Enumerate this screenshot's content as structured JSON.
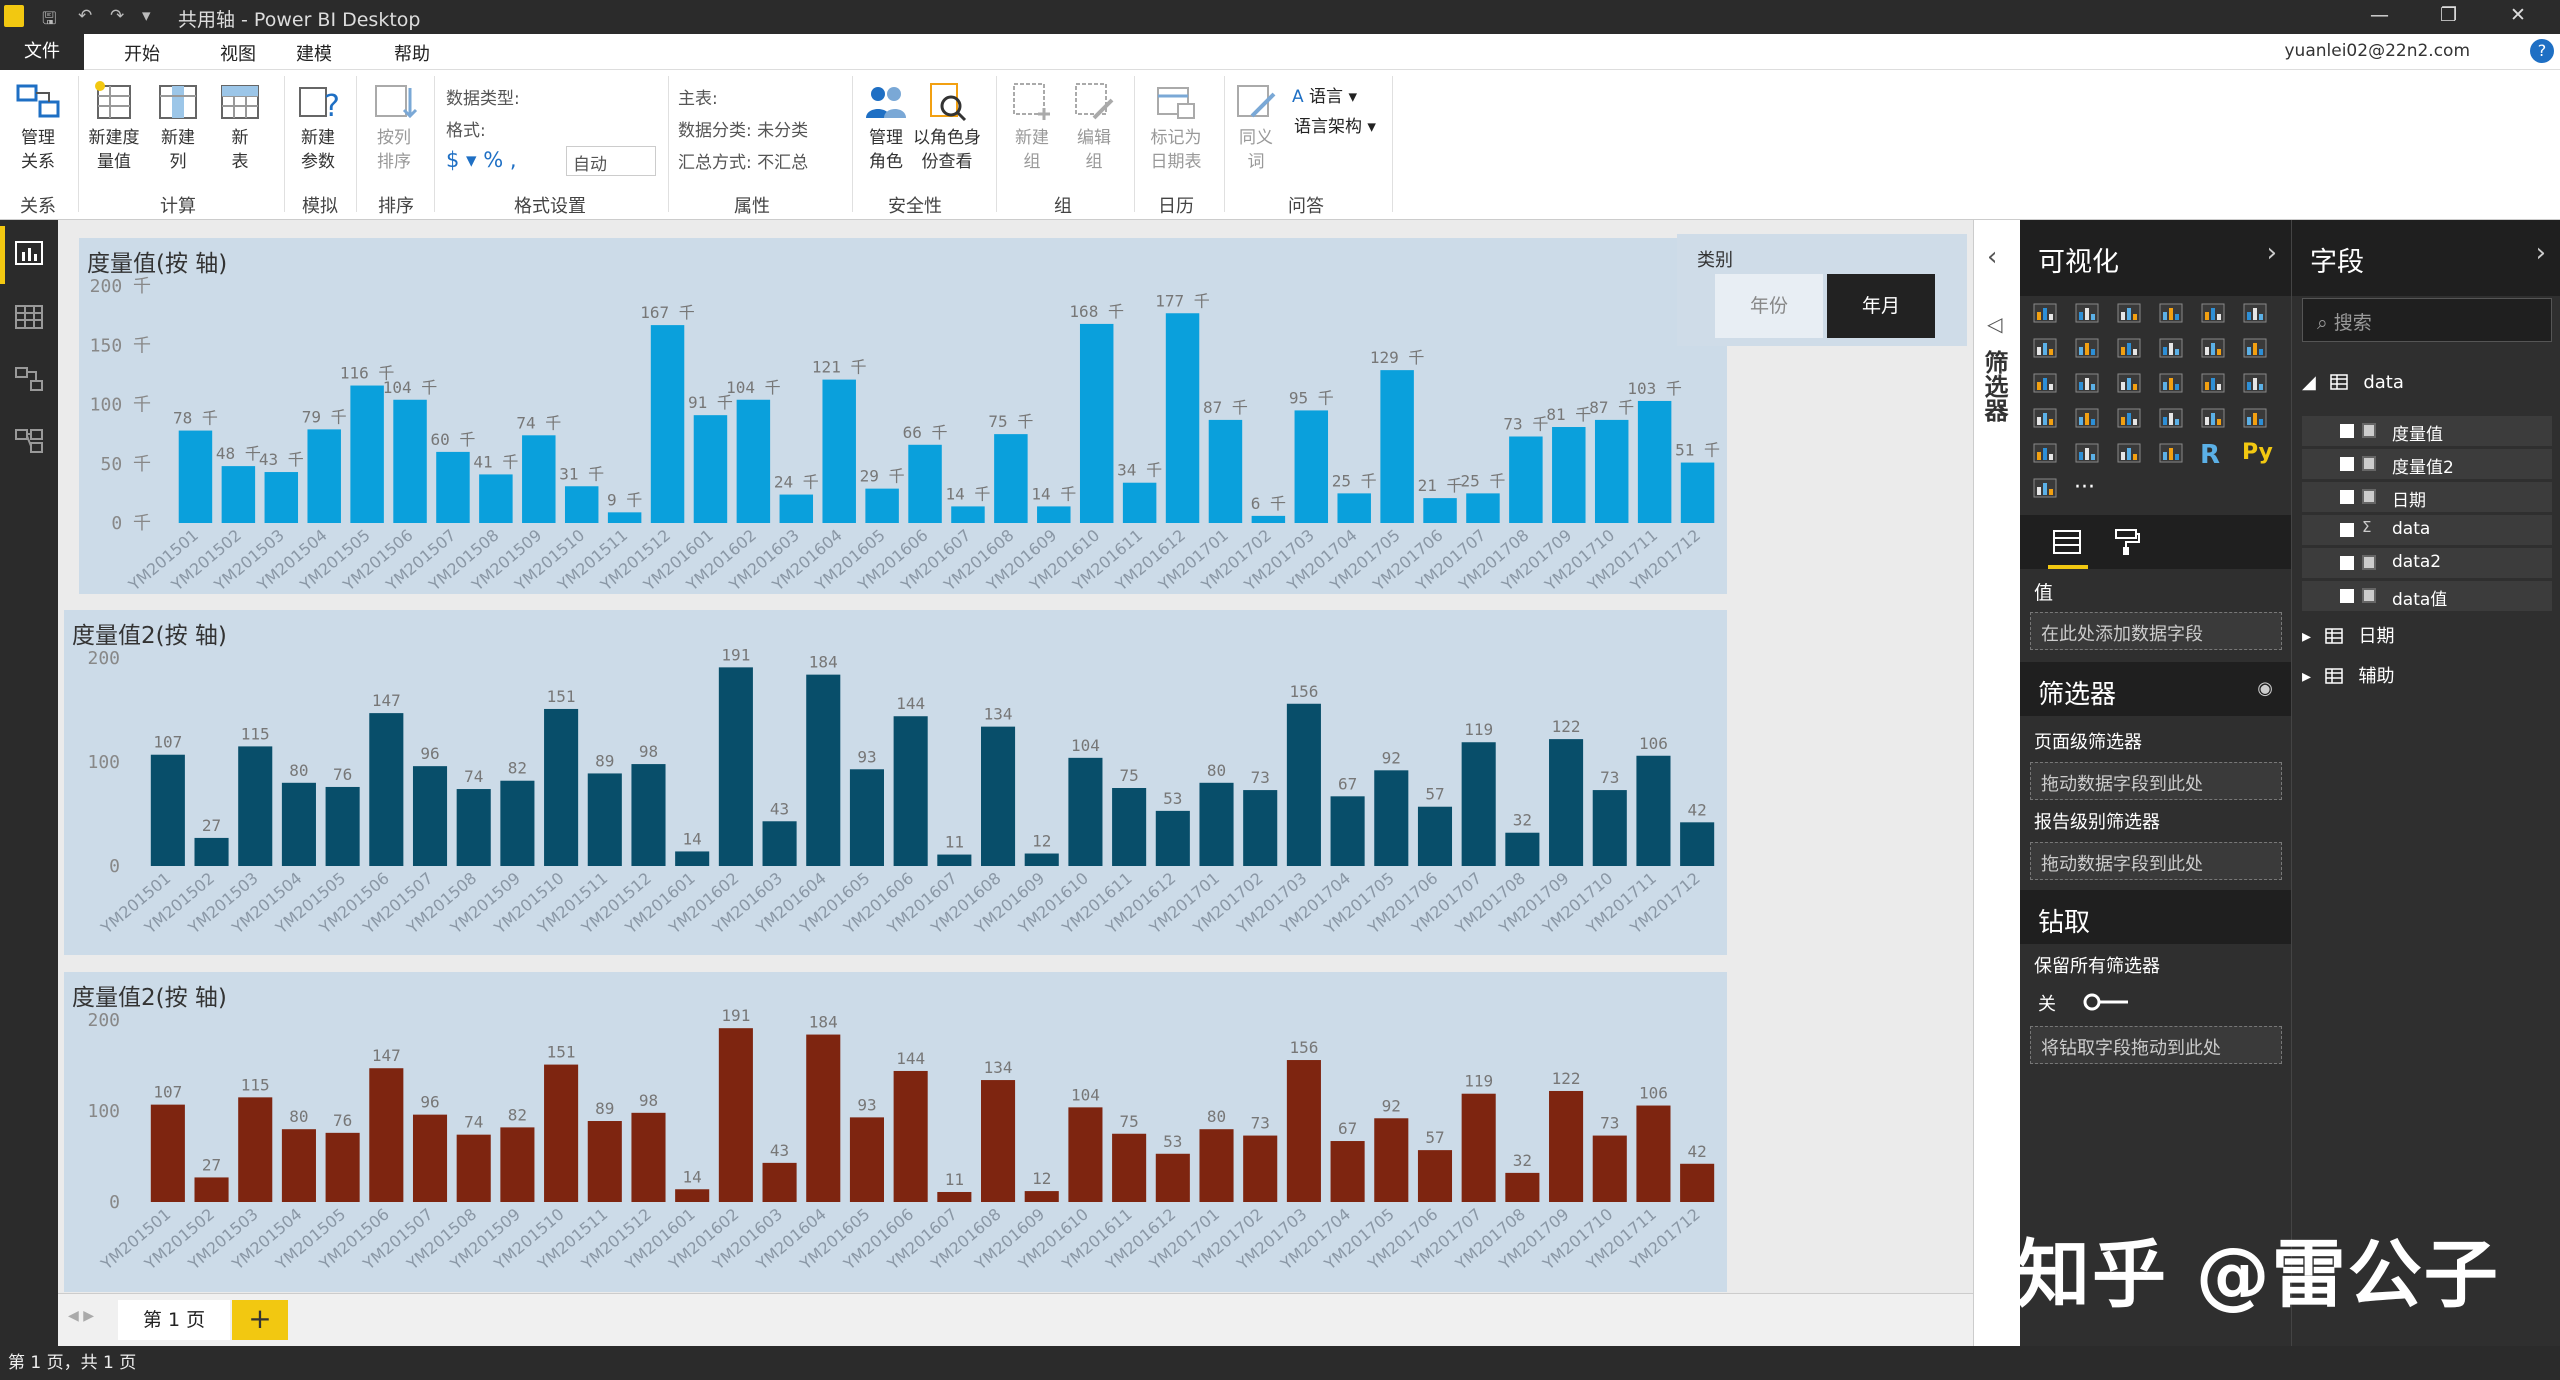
{
  "window": {
    "title": "共用轴 - Power BI Desktop",
    "user": "yuanlei02@22n2.com",
    "help": "?"
  },
  "menu": {
    "file": "文件",
    "tabs": [
      "开始",
      "视图",
      "建模",
      "帮助"
    ],
    "active": "建模"
  },
  "ribbon": {
    "buttons": [
      {
        "label1": "管理",
        "label2": "关系",
        "icon": "manage-relationships-icon"
      },
      {
        "label1": "新建度",
        "label2": "量值",
        "icon": "new-measure-icon"
      },
      {
        "label1": "新建",
        "label2": "列",
        "icon": "new-column-icon"
      },
      {
        "label1": "新",
        "label2": "表",
        "icon": "new-table-icon"
      },
      {
        "label1": "新建",
        "label2": "参数",
        "icon": "new-parameter-icon"
      },
      {
        "label1": "按列",
        "label2": "排序",
        "icon": "sort-by-column-icon"
      },
      {
        "label1": "管理",
        "label2": "角色",
        "icon": "manage-roles-icon"
      },
      {
        "label1": "以角色身",
        "label2": "份查看",
        "icon": "view-as-roles-icon"
      },
      {
        "label1": "新建",
        "label2": "组",
        "icon": "new-group-icon"
      },
      {
        "label1": "编辑",
        "label2": "组",
        "icon": "edit-groups-icon"
      },
      {
        "label1": "标记为",
        "label2": "日期表",
        "icon": "mark-date-table-icon"
      },
      {
        "label1": "同义",
        "label2": "词",
        "icon": "synonyms-icon"
      }
    ],
    "groups": [
      "关系",
      "计算",
      "模拟",
      "排序",
      "格式设置",
      "属性",
      "安全性",
      "组",
      "日历",
      "问答"
    ],
    "format": {
      "datatype": "数据类型:",
      "format": "格式:",
      "symbols": "$ ▾  %  ,",
      "auto": "自动"
    },
    "properties": {
      "home_table": "主表:",
      "data_category": "数据分类: 未分类",
      "summarize": "汇总方式: 不汇总"
    },
    "qa": {
      "language": "语言",
      "schema": "语言架构"
    }
  },
  "slicer": {
    "title": "类别",
    "options": [
      "年份",
      "年月"
    ],
    "selected": "年月"
  },
  "charts": {
    "chart1_title": "度量值(按 轴)",
    "chart2_title": "度量值2(按 轴)",
    "chart3_title": "度量值2(按 轴)"
  },
  "chart_data": [
    {
      "type": "bar",
      "title": "度量值(按 轴)",
      "categories": [
        "YM201501",
        "YM201502",
        "YM201503",
        "YM201504",
        "YM201505",
        "YM201506",
        "YM201507",
        "YM201508",
        "YM201509",
        "YM201510",
        "YM201511",
        "YM201512",
        "YM201601",
        "YM201602",
        "YM201603",
        "YM201604",
        "YM201605",
        "YM201606",
        "YM201607",
        "YM201608",
        "YM201609",
        "YM201610",
        "YM201611",
        "YM201612",
        "YM201701",
        "YM201702",
        "YM201703",
        "YM201704",
        "YM201705",
        "YM201706",
        "YM201707",
        "YM201708",
        "YM201709",
        "YM201710",
        "YM201711",
        "YM201712"
      ],
      "values": [
        78,
        48,
        43,
        79,
        116,
        104,
        60,
        41,
        74,
        31,
        9,
        167,
        91,
        104,
        24,
        121,
        29,
        66,
        14,
        75,
        14,
        168,
        34,
        177,
        87,
        6,
        95,
        25,
        129,
        21,
        25,
        73,
        81,
        87,
        103,
        51
      ],
      "labels": [
        "78 千",
        "48 千",
        "43 千",
        "79 千",
        "116 千",
        "104 千",
        "60 千",
        "41 千",
        "74 千",
        "31 千",
        "9 千",
        "167 千",
        "91 千",
        "104 千",
        "24 千",
        "121 千",
        "29 千",
        "66 千",
        "14 千",
        "75 千",
        "14 千",
        "168 千",
        "34 千",
        "177 千",
        "87 千",
        "6 千",
        "95 千",
        "25 千",
        "129 千",
        "21 千",
        "25 千",
        "73 千",
        "81 千",
        "87 千",
        "103 千",
        "51 千"
      ],
      "yticks": [
        "200 千",
        "150 千",
        "100 千",
        "50 千",
        "0 千"
      ],
      "ylim": [
        0,
        200
      ],
      "color": "#0aa0dc"
    },
    {
      "type": "bar",
      "title": "度量值2(按 轴)",
      "categories": [
        "YM201501",
        "YM201502",
        "YM201503",
        "YM201504",
        "YM201505",
        "YM201506",
        "YM201507",
        "YM201508",
        "YM201509",
        "YM201510",
        "YM201511",
        "YM201512",
        "YM201601",
        "YM201602",
        "YM201603",
        "YM201604",
        "YM201605",
        "YM201606",
        "YM201607",
        "YM201608",
        "YM201609",
        "YM201610",
        "YM201611",
        "YM201612",
        "YM201701",
        "YM201702",
        "YM201703",
        "YM201704",
        "YM201705",
        "YM201706",
        "YM201707",
        "YM201708",
        "YM201709",
        "YM201710",
        "YM201711",
        "YM201712"
      ],
      "values": [
        107,
        27,
        115,
        80,
        76,
        147,
        96,
        74,
        82,
        151,
        89,
        98,
        14,
        191,
        43,
        184,
        93,
        144,
        11,
        134,
        12,
        104,
        75,
        53,
        80,
        73,
        156,
        67,
        92,
        57,
        119,
        32,
        122,
        73,
        106,
        42
      ],
      "labels": [
        "107",
        "27",
        "115",
        "80",
        "76",
        "147",
        "96",
        "74",
        "82",
        "151",
        "89",
        "98",
        "14",
        "191",
        "43",
        "184",
        "93",
        "144",
        "11",
        "134",
        "12",
        "104",
        "75",
        "53",
        "80",
        "73",
        "156",
        "67",
        "92",
        "57",
        "119",
        "32",
        "122",
        "73",
        "106",
        "42"
      ],
      "yticks": [
        "200",
        "100",
        "0"
      ],
      "ylim": [
        0,
        200
      ],
      "color": "#084e6a"
    },
    {
      "type": "bar",
      "title": "度量值2(按 轴)",
      "categories": [
        "YM201501",
        "YM201502",
        "YM201503",
        "YM201504",
        "YM201505",
        "YM201506",
        "YM201507",
        "YM201508",
        "YM201509",
        "YM201510",
        "YM201511",
        "YM201512",
        "YM201601",
        "YM201602",
        "YM201603",
        "YM201604",
        "YM201605",
        "YM201606",
        "YM201607",
        "YM201608",
        "YM201609",
        "YM201610",
        "YM201611",
        "YM201612",
        "YM201701",
        "YM201702",
        "YM201703",
        "YM201704",
        "YM201705",
        "YM201706",
        "YM201707",
        "YM201708",
        "YM201709",
        "YM201710",
        "YM201711",
        "YM201712"
      ],
      "values": [
        107,
        27,
        115,
        80,
        76,
        147,
        96,
        74,
        82,
        151,
        89,
        98,
        14,
        191,
        43,
        184,
        93,
        144,
        11,
        134,
        12,
        104,
        75,
        53,
        80,
        73,
        156,
        67,
        92,
        57,
        119,
        32,
        122,
        73,
        106,
        42
      ],
      "labels": [
        "107",
        "27",
        "115",
        "80",
        "76",
        "147",
        "96",
        "74",
        "82",
        "151",
        "89",
        "98",
        "14",
        "191",
        "43",
        "184",
        "93",
        "144",
        "11",
        "134",
        "12",
        "104",
        "75",
        "53",
        "80",
        "73",
        "156",
        "67",
        "92",
        "57",
        "119",
        "32",
        "122",
        "73",
        "106",
        "42"
      ],
      "yticks": [
        "200",
        "100",
        "0"
      ],
      "ylim": [
        0,
        200
      ],
      "color": "#7e2510"
    }
  ],
  "pages": {
    "tab": "第 1 页",
    "add": "+"
  },
  "status": "第 1 页，共 1 页",
  "filter_strip": {
    "label": "筛选器"
  },
  "viz": {
    "header": "可视化",
    "values_label": "值",
    "values_drop": "在此处添加数据字段",
    "filters_header": "筛选器",
    "page_filters": "页面级筛选器",
    "page_drop": "拖动数据字段到此处",
    "report_filters": "报告级别筛选器",
    "report_drop": "拖动数据字段到此处",
    "drill_header": "钻取",
    "keep_filters": "保留所有筛选器",
    "toggle_off": "关",
    "drill_drop": "将钻取字段拖动到此处",
    "r_label": "R",
    "py_label": "Py",
    "more": "···"
  },
  "fields": {
    "header": "字段",
    "search_placeholder": "搜索",
    "tables": [
      {
        "name": "data",
        "expanded": true,
        "fields": [
          "度量值",
          "度量值2",
          "日期",
          "data",
          "data2",
          "data值"
        ]
      },
      {
        "name": "日期",
        "expanded": false
      },
      {
        "name": "辅助",
        "expanded": false
      }
    ]
  },
  "watermark": "知乎 @雷公子"
}
